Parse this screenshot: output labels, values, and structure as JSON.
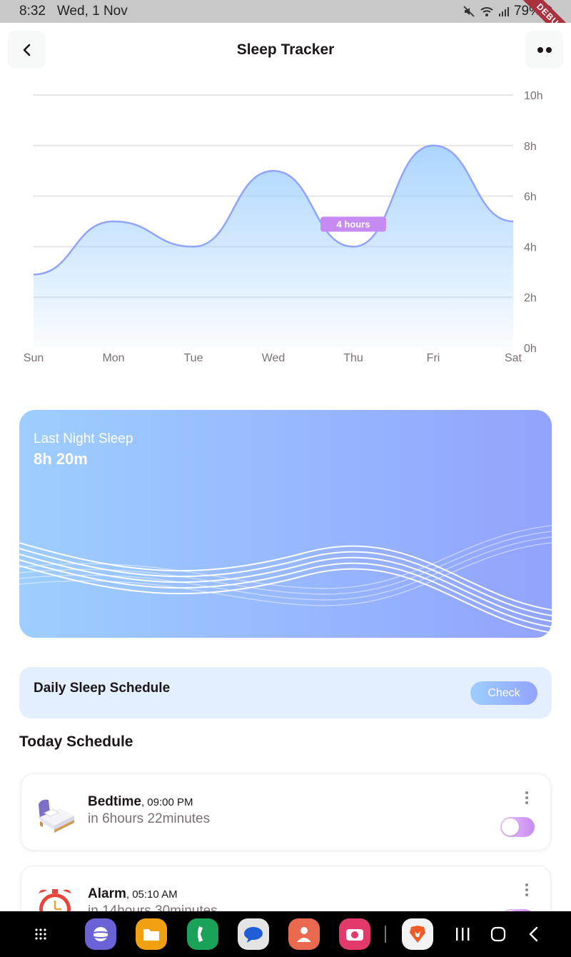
{
  "status_bar": {
    "time": "8:32",
    "date": "Wed, 1 Nov",
    "battery": "79%",
    "debug_label": "DEBUG"
  },
  "header": {
    "title": "Sleep Tracker",
    "back_icon": "chevron-left-icon",
    "more_icon": "more-dots-icon"
  },
  "chart_data": {
    "type": "area",
    "categories": [
      "Sun",
      "Mon",
      "Tue",
      "Wed",
      "Thu",
      "Fri",
      "Sat"
    ],
    "y_tick_labels": [
      "0h",
      "2h",
      "4h",
      "6h",
      "8h",
      "10h"
    ],
    "ylim": [
      0,
      10
    ],
    "series": [
      {
        "values": [
          2.9,
          5.0,
          4.0,
          7.0,
          4.0,
          8.0,
          5.0
        ]
      }
    ],
    "tooltip": {
      "category": "Thu",
      "label": "4 hours"
    },
    "grid": true,
    "y_axis_position": "right",
    "line_color": "#92a3fd",
    "fill_color": "#9dceff",
    "tooltip_color": "#c58bf2"
  },
  "last_night": {
    "label": "Last Night Sleep",
    "value": "8h 20m"
  },
  "daily_schedule": {
    "title": "Daily Sleep Schedule",
    "button_label": "Check"
  },
  "today": {
    "title": "Today Schedule",
    "items": [
      {
        "name": "Bedtime",
        "time": ", 09:00 PM",
        "remaining": "in 6hours 22minutes",
        "icon": "bed-icon",
        "enabled": true
      },
      {
        "name": "Alarm",
        "time": ", 05:10 AM",
        "remaining": "in 14hours 30minutes",
        "icon": "alarm-clock-icon",
        "enabled": true
      }
    ]
  },
  "nav_bar": {
    "apps": [
      "app-drawer-icon",
      "browser-icon",
      "files-icon",
      "phone-icon",
      "messages-icon",
      "contacts-icon",
      "camera-icon",
      "brave-icon"
    ],
    "buttons": [
      "recents-icon",
      "home-icon",
      "back-icon"
    ]
  },
  "colors": {
    "brand_blue": "#92a3fd",
    "light_blue": "#9dceff",
    "purple": "#c58bf2",
    "text_dark": "#1d1617",
    "text_gray": "#7b6f72"
  }
}
